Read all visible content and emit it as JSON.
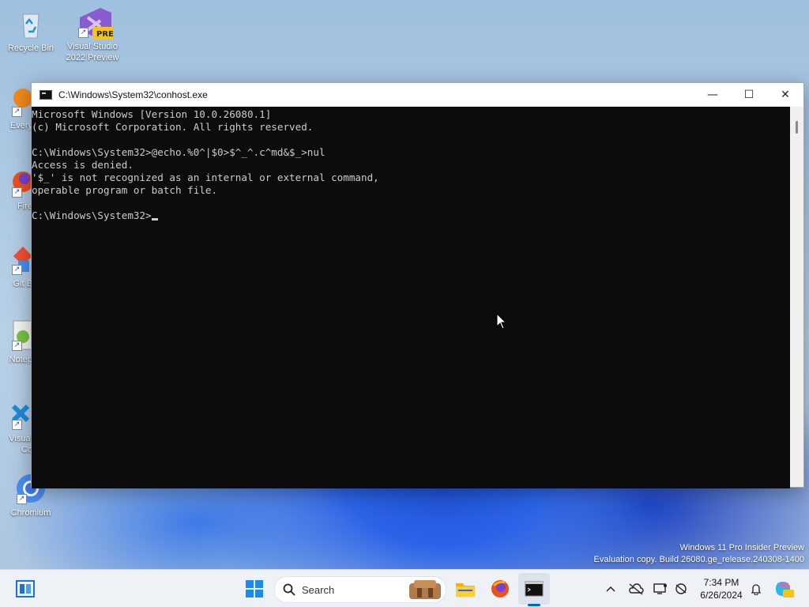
{
  "desktop": {
    "icons": [
      {
        "label": "Recycle Bin"
      },
      {
        "label": "Visual Studio 2022 Preview",
        "badge": "PRE"
      },
      {
        "label": "Every"
      },
      {
        "label": "Fire"
      },
      {
        "label": "Git B"
      },
      {
        "label": "Notep"
      },
      {
        "label": "Visual Co"
      },
      {
        "label": "Chromium"
      }
    ]
  },
  "window": {
    "title": "C:\\Windows\\System32\\conhost.exe",
    "controls": {
      "minimize": "—",
      "maximize": "☐",
      "close": "✕"
    },
    "console_lines": [
      "Microsoft Windows [Version 10.0.26080.1]",
      "(c) Microsoft Corporation. All rights reserved.",
      "",
      "C:\\Windows\\System32>@echo.%0^|$0>$^_^.c^md&$_>nul",
      "Access is denied.",
      "'$_' is not recognized as an internal or external command,",
      "operable program or batch file.",
      "",
      "C:\\Windows\\System32>"
    ]
  },
  "watermark": {
    "line1": "Windows 11 Pro Insider Preview",
    "line2": "Evaluation copy. Build 26080.ge_release.240308-1400"
  },
  "taskbar": {
    "search_label": "Search",
    "time": "7:34 PM",
    "date": "6/26/2024",
    "colors": {
      "accent": "#0067c0"
    }
  }
}
